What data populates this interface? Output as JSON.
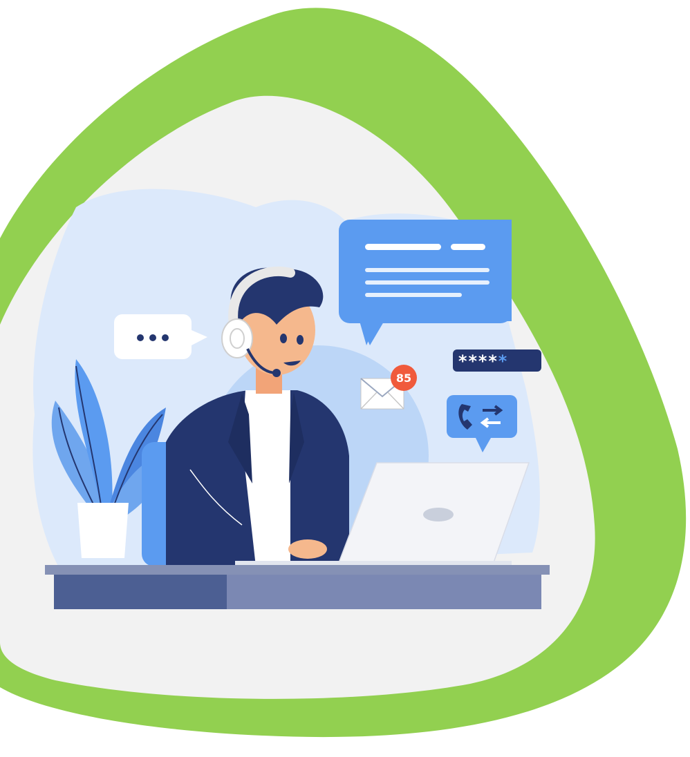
{
  "illustration": {
    "notification_count": "85",
    "password_mask": "****",
    "password_mask_last": "*"
  },
  "colors": {
    "accent_green": "#92d050",
    "backdrop_gray": "#f2f2f2",
    "light_blue": "#dce9fb",
    "mid_blue": "#bcd6f7",
    "bubble_blue": "#5b9bf0",
    "navy": "#24366f",
    "badge_red": "#f05a3c"
  },
  "icons": [
    "chat-typing-icon",
    "message-bubble-icon",
    "mail-icon",
    "notification-badge-icon",
    "password-field-icon",
    "phone-transfer-icon",
    "headset-icon",
    "laptop-icon",
    "plant-icon"
  ]
}
